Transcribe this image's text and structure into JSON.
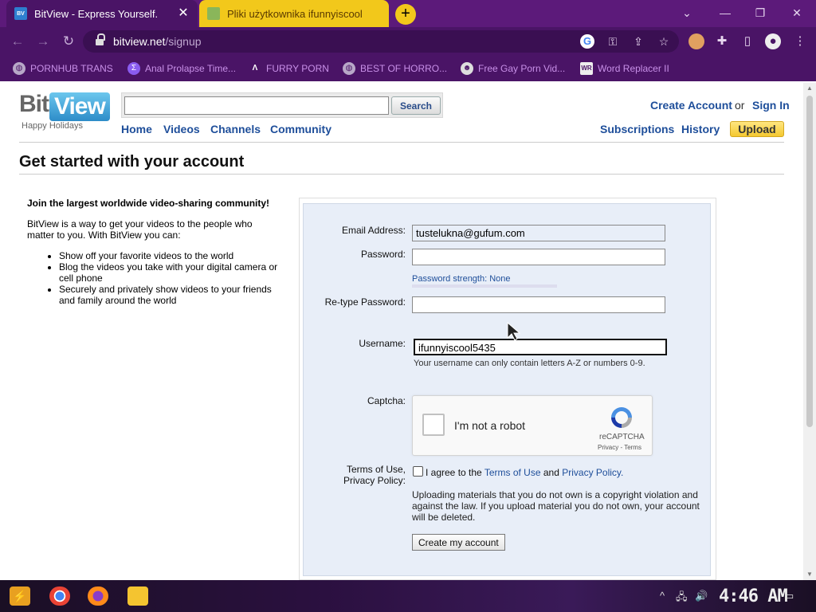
{
  "browser": {
    "tabs": [
      {
        "title": "BitView - Express Yourself.",
        "favicon": "bitview-favicon",
        "active": true
      },
      {
        "title": "Pliki użytkownika ifunnyiscool",
        "favicon": "folder-favicon",
        "active": false
      }
    ],
    "new_tab": "+",
    "url_host": "bitview.net",
    "url_path": "/signup",
    "bookmarks": [
      {
        "label": "PORNHUB TRANS",
        "icon": "globe-icon"
      },
      {
        "label": "Anal Prolapse Time...",
        "icon": "bookmark-icon"
      },
      {
        "label": "FURRY PORN",
        "icon": "arch-icon"
      },
      {
        "label": "BEST OF HORRO...",
        "icon": "globe-icon"
      },
      {
        "label": "Free Gay Porn Vid...",
        "icon": "bot-icon"
      },
      {
        "label": "Word Replacer II",
        "icon": "wr-icon"
      }
    ]
  },
  "site": {
    "logo_bit": "Bit",
    "logo_view": "View",
    "logo_tag": "Happy Holidays",
    "search_button": "Search",
    "search_value": "",
    "nav": [
      "Home",
      "Videos",
      "Channels",
      "Community"
    ],
    "create_account": "Create Account",
    "or": "or",
    "sign_in": "Sign In",
    "subscriptions": "Subscriptions",
    "history": "History",
    "upload": "Upload"
  },
  "page": {
    "title": "Get started with your account",
    "intro_heading": "Join the largest worldwide video-sharing community!",
    "intro_text": "BitView is a way to get your videos to the people who matter to you. With BitView you can:",
    "bullets": [
      "Show off your favorite videos to the world",
      "Blog the videos you take with your digital camera or cell phone",
      "Securely and privately show videos to your friends and family around the world"
    ]
  },
  "form": {
    "email_label": "Email Address:",
    "email_value": "tustelukna@gufum.com",
    "password_label": "Password:",
    "password_value": "",
    "password_strength": "Password strength: None",
    "retype_label": "Re-type Password:",
    "retype_value": "",
    "username_label": "Username:",
    "username_value": "ifunnyiscool5435",
    "username_hint": "Your username can only contain letters A-Z or numbers 0-9.",
    "captcha_label": "Captcha:",
    "captcha_text": "I'm not a robot",
    "captcha_brand": "reCAPTCHA",
    "captcha_terms": "Privacy - Terms",
    "terms_label_1": "Terms of Use,",
    "terms_label_2": "Privacy Policy:",
    "agree_prefix": "I agree to the",
    "agree_terms": "Terms of Use",
    "agree_and": "and",
    "agree_privacy": "Privacy Policy.",
    "legal_text": "Uploading materials that you do not own is a copyright violation and against the law. If you upload material you do not own, your account will be deleted.",
    "submit": "Create my account"
  },
  "taskbar": {
    "clock": "4:46 AM"
  }
}
